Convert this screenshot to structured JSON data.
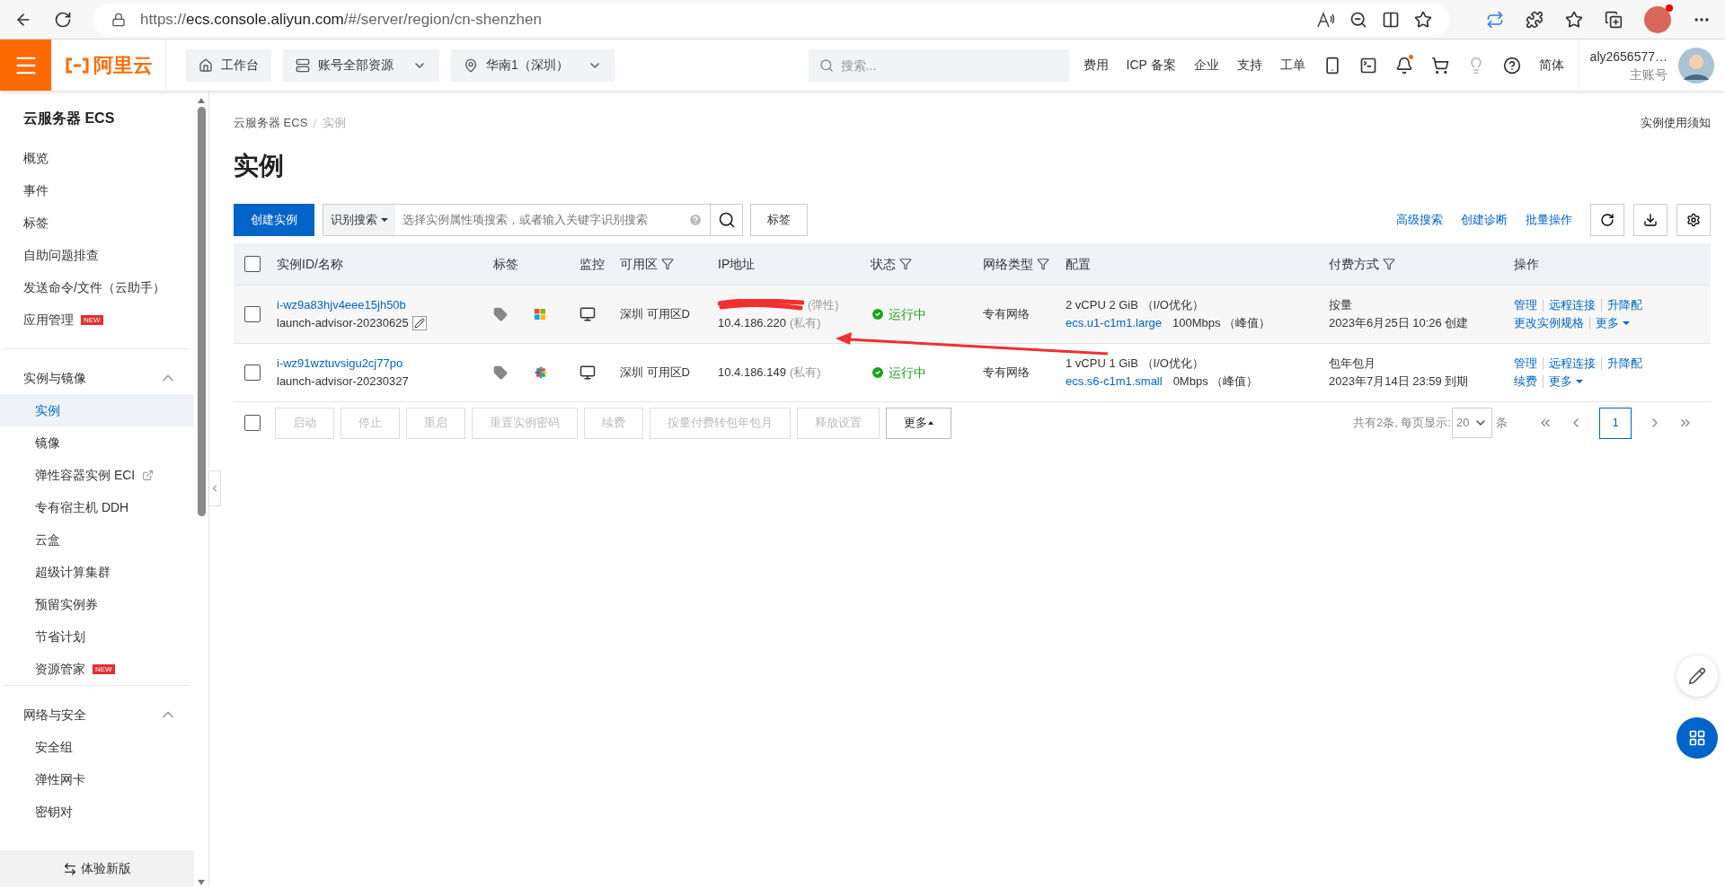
{
  "browser": {
    "url_scheme": "https://",
    "url_host": "ecs.console.aliyun.com",
    "url_path": "/#/server/region/cn-shenzhen"
  },
  "top_nav": {
    "logo": "阿里云",
    "buttons": [
      {
        "kind": "home",
        "label": "工作台"
      },
      {
        "kind": "resources",
        "label": "账号全部资源"
      },
      {
        "kind": "region",
        "label": "华南1（深圳）"
      }
    ],
    "search": {
      "placeholder": "搜索..."
    },
    "links": [
      "费用",
      "ICP 备案",
      "企业",
      "支持",
      "工单"
    ],
    "language": "简体",
    "user": {
      "name": "aly2656577…",
      "role": "主账号"
    }
  },
  "sidebar": {
    "title": "云服务器 ECS",
    "groups": [
      {
        "items": [
          {
            "label": "概览",
            "selected": false
          },
          {
            "label": "事件",
            "selected": false
          },
          {
            "label": "标签",
            "selected": false
          },
          {
            "label": "自助问题排查",
            "selected": false
          },
          {
            "label": "发送命令/文件（云助手）",
            "selected": false
          },
          {
            "label": "应用管理",
            "selected": false,
            "badge": "NEW"
          }
        ]
      },
      {
        "heading": "实例与镜像",
        "expanded": true,
        "items": [
          {
            "label": "实例",
            "selected": true
          },
          {
            "label": "镜像",
            "selected": false
          },
          {
            "label": "弹性容器实例 ECI",
            "selected": false,
            "external": true
          },
          {
            "label": "专有宿主机 DDH",
            "selected": false
          },
          {
            "label": "云盒",
            "selected": false
          },
          {
            "label": "超级计算集群",
            "selected": false
          },
          {
            "label": "预留实例券",
            "selected": false
          },
          {
            "label": "节省计划",
            "selected": false
          },
          {
            "label": "资源管家",
            "selected": false,
            "badge": "NEW"
          }
        ]
      },
      {
        "heading": "网络与安全",
        "expanded": true,
        "items": [
          {
            "label": "安全组",
            "selected": false
          },
          {
            "label": "弹性网卡",
            "selected": false
          },
          {
            "label": "密钥对",
            "selected": false
          }
        ]
      }
    ],
    "footer": "体验新版"
  },
  "main": {
    "breadcrumb": [
      "云服务器 ECS",
      "实例"
    ],
    "notice": "实例使用须知",
    "title": "实例",
    "create_button": "创建实例",
    "search": {
      "scope": "识别搜索",
      "placeholder": "选择实例属性项搜索，或者输入关键字识别搜索"
    },
    "tag_button": "标签",
    "links": [
      "高级搜索",
      "创建诊断",
      "批量操作"
    ],
    "table": {
      "header_checked": false,
      "columns": [
        {
          "label": "实例ID/名称",
          "filter": false
        },
        {
          "label": "标签",
          "filter": false
        },
        {
          "label": "监控",
          "filter": false
        },
        {
          "label": "可用区",
          "filter": true
        },
        {
          "label": "IP地址",
          "filter": false
        },
        {
          "label": "状态",
          "filter": true
        },
        {
          "label": "网络类型",
          "filter": true
        },
        {
          "label": "配置",
          "filter": false
        },
        {
          "label": "付费方式",
          "filter": true
        },
        {
          "label": "操作",
          "filter": false
        }
      ],
      "rows": [
        {
          "highlighted": true,
          "checked": false,
          "id": "i-wz9a83hjv4eee15jh50b",
          "name": "launch-advisor-20230625",
          "editable": true,
          "kind": "windows",
          "zone": "深圳 可用区D",
          "ips": [
            {
              "redacted": true,
              "type": "(弹性)"
            },
            {
              "address": "10.4.186.220",
              "type": "(私有)"
            }
          ],
          "status": "运行中",
          "network": "专有网络",
          "config": "2 vCPU 2 GiB （I/O优化）",
          "spec": "ecs.u1-c1m1.large",
          "bandwidth": "100Mbps （峰值）",
          "billing": "按量",
          "billing_time": "2023年6月25日 10:26 创建",
          "actions": [
            "管理",
            "远程连接",
            "升降配"
          ],
          "actions_2": [
            "更改实例规格"
          ],
          "more": "更多"
        },
        {
          "highlighted": false,
          "checked": false,
          "id": "i-wz91wztuvsigu2cj77po",
          "name": "launch-advisor-20230327",
          "editable": false,
          "kind": "other",
          "zone": "深圳 可用区D",
          "ips": [
            {
              "address": "10.4.186.149",
              "type": "(私有)"
            }
          ],
          "status": "运行中",
          "network": "专有网络",
          "config": "1 vCPU 1 GiB （I/O优化）",
          "spec": "ecs.s6-c1m1.small",
          "bandwidth": "0Mbps （峰值）",
          "billing": "包年包月",
          "billing_time": "2023年7月14日 23:59 到期",
          "actions": [
            "管理",
            "远程连接",
            "升降配"
          ],
          "actions_2": [
            "续费"
          ],
          "more": "更多"
        }
      ]
    },
    "select_all_checked": false,
    "bulk_actions": [
      {
        "label": "启动",
        "disabled": true
      },
      {
        "label": "停止",
        "disabled": true
      },
      {
        "label": "重启",
        "disabled": true
      },
      {
        "label": "重置实例密码",
        "disabled": true
      },
      {
        "label": "续费",
        "disabled": true
      },
      {
        "label": "按量付费转包年包月",
        "disabled": true
      },
      {
        "label": "释放设置",
        "disabled": true
      },
      {
        "label": "更多",
        "disabled": false,
        "menu": true
      }
    ],
    "pagination": {
      "summary": "共有2条, 每页显示:",
      "page_size": "20",
      "unit": "条",
      "pages": [
        {
          "label": "1",
          "selected": true
        }
      ]
    }
  }
}
